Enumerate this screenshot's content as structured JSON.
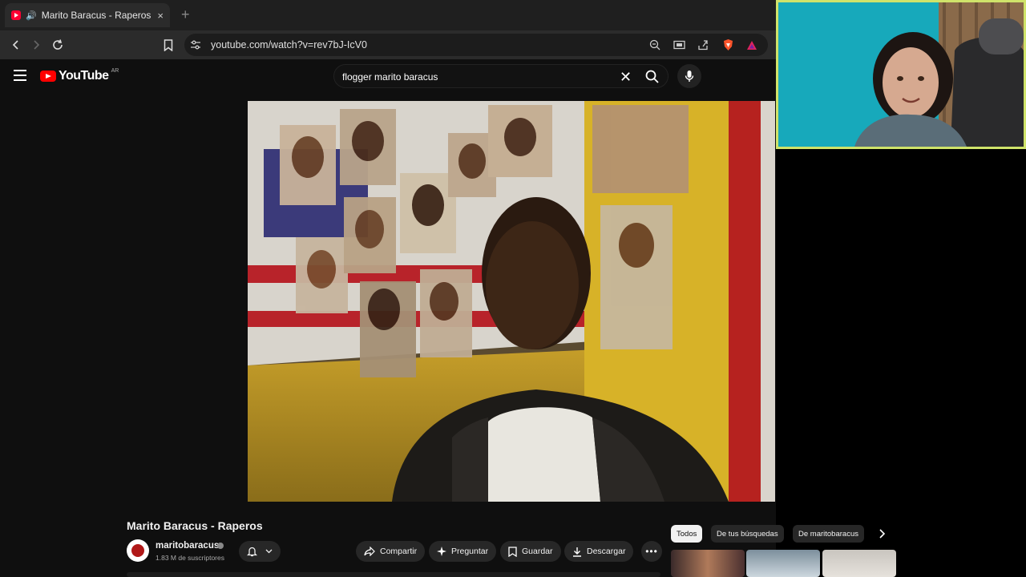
{
  "browser": {
    "tab_title": "Marito Baracus - Raperos - YouTube",
    "tab_close": "×",
    "new_tab": "+",
    "url": "youtube.com/watch?v=rev7bJ-IcV0"
  },
  "masthead": {
    "logo_text": "YouTube",
    "country": "AR",
    "search_query": "flogger marito baracus",
    "clear_symbol": "✕"
  },
  "video": {
    "title": "Marito Baracus - Raperos"
  },
  "channel": {
    "name": "maritobaracus",
    "subscribers": "1.83 M de suscriptores"
  },
  "actions": {
    "share": "Compartir",
    "ask": "Preguntar",
    "save": "Guardar",
    "download": "Descargar",
    "more": "•••"
  },
  "chips": [
    "Todos",
    "De tus búsquedas",
    "De maritobaracus"
  ],
  "colors": {
    "accent_red": "#ff0000",
    "webcam_border": "#cfe36a"
  }
}
